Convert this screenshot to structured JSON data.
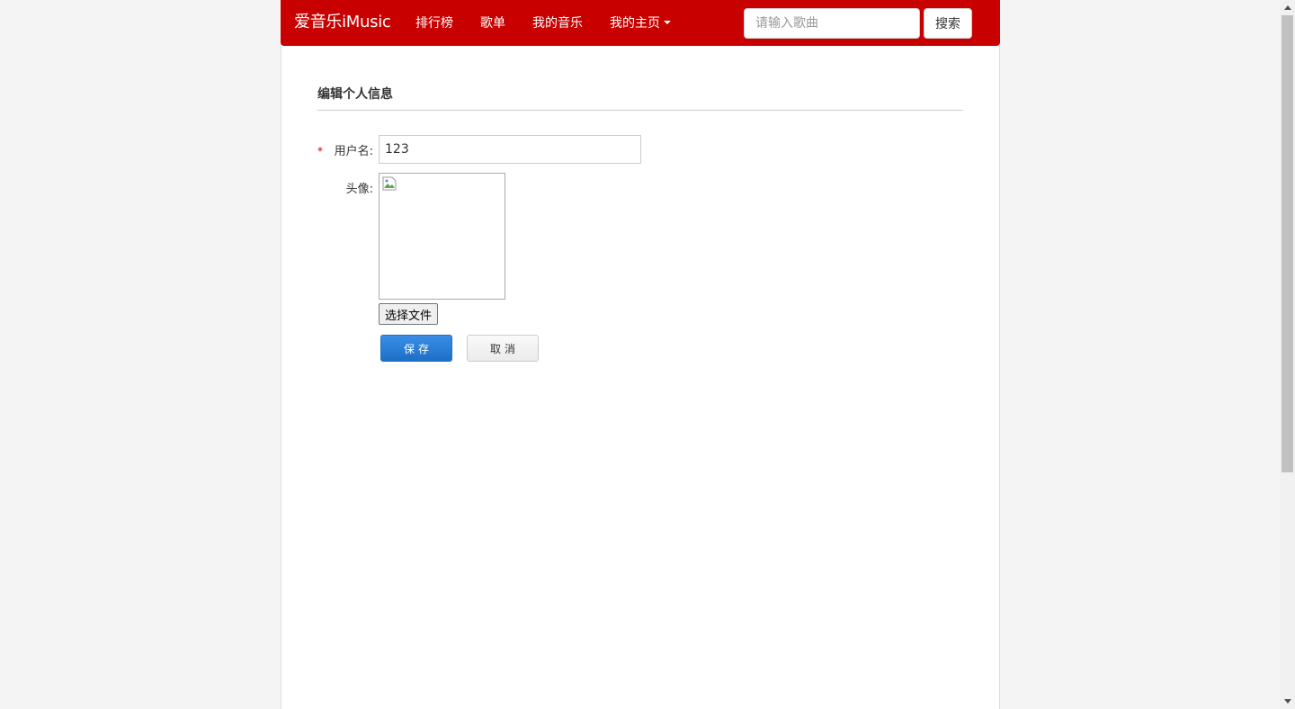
{
  "navbar": {
    "brand": "爱音乐iMusic",
    "items": [
      {
        "label": "排行榜"
      },
      {
        "label": "歌单"
      },
      {
        "label": "我的音乐"
      },
      {
        "label": "我的主页"
      }
    ],
    "search_placeholder": "请输入歌曲",
    "search_button": "搜索",
    "color": "#c90000"
  },
  "form": {
    "title": "编辑个人信息",
    "required_mark": "*",
    "username_label": "用户名:",
    "username_value": "123",
    "avatar_label": "头像:",
    "file_button": "选择文件",
    "save_button": "保存",
    "cancel_button": "取消",
    "save_color": "#1e6fc6"
  },
  "icons": {
    "dropdown": "caret-down-icon",
    "avatar_placeholder": "broken-image-icon"
  }
}
